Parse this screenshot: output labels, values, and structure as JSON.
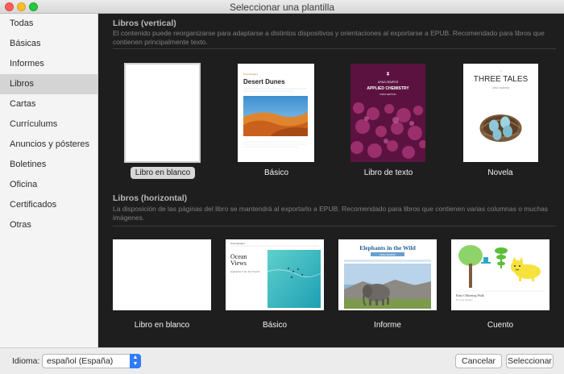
{
  "window": {
    "title": "Seleccionar una plantilla"
  },
  "sidebar": {
    "items": [
      {
        "label": "Todas"
      },
      {
        "label": "Básicas"
      },
      {
        "label": "Informes"
      },
      {
        "label": "Libros",
        "selected": true
      },
      {
        "label": "Cartas"
      },
      {
        "label": "Currículums"
      },
      {
        "label": "Anuncios y pósteres"
      },
      {
        "label": "Boletines"
      },
      {
        "label": "Oficina"
      },
      {
        "label": "Certificados"
      },
      {
        "label": "Otras"
      }
    ]
  },
  "main": {
    "portrait": {
      "title": "Libros (vertical)",
      "desc": "El contenido puede reorganizarse para adaptarse a distintos dispositivos y orientaciones al exportarse a EPUB. Recomendado para libros que contienen principalmente texto.",
      "templates": [
        {
          "label": "Libro en blanco",
          "selected": true
        },
        {
          "label": "Básico",
          "cover_kicker": "Urna Semper",
          "cover_title": "Desert Dunes"
        },
        {
          "label": "Libro de texto",
          "cover_author": "URNA SEMPER",
          "cover_title": "APPLIED CHEMISTRY",
          "cover_edition": "FIRST EDITION"
        },
        {
          "label": "Novela",
          "cover_title": "THREE TALES",
          "cover_author": "URNA SEMPER"
        }
      ]
    },
    "landscape": {
      "title": "Libros (horizontal)",
      "desc": "La disposición de las páginas del libro se mantendrá al exportarlo a EPUB. Recomendado para libros que contienen varias columnas o muchas imágenes.",
      "templates": [
        {
          "label": "Libro en blanco"
        },
        {
          "label": "Básico",
          "cover_kicker": "Urna Semper",
          "cover_title_1": "Ocean",
          "cover_title_2": "Views",
          "cover_sub": "Highlights From My Travels"
        },
        {
          "label": "Informe",
          "cover_title": "Elephants in the Wild",
          "cover_author": "URNA SEMPER"
        },
        {
          "label": "Cuento",
          "cover_title": "Kitty's Morning Walk",
          "cover_author": "By Urna Semper"
        }
      ]
    }
  },
  "bottom": {
    "lang_label": "Idioma:",
    "lang_value": "español (España)",
    "cancel_label": "Cancelar",
    "select_label": "Seleccionar"
  },
  "colors": {
    "main_bg": "#1e1e1e",
    "accent": "#2f7cf6",
    "sidebar_selected": "#d4d4d4"
  }
}
